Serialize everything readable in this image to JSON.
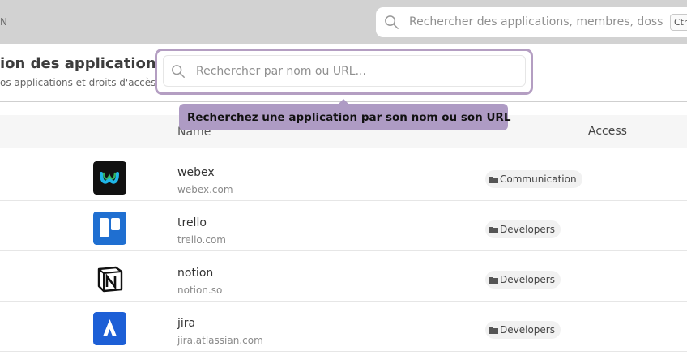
{
  "topbar": {
    "brand": "N",
    "global_search_placeholder": "Rechercher des applications, membres, doss",
    "shortcut": "Ctr"
  },
  "page": {
    "title": "ion des applications",
    "subtitle": "os applications et droits d'accès"
  },
  "search": {
    "placeholder": "Rechercher par nom ou URL..."
  },
  "tooltip": {
    "text": "Recherchez une application par son nom ou son URL"
  },
  "table": {
    "columns": {
      "name": "Name",
      "access": "Access"
    },
    "rows": [
      {
        "name": "webex",
        "url": "webex.com",
        "tag": "Communication",
        "logo": "webex-logo"
      },
      {
        "name": "trello",
        "url": "trello.com",
        "tag": "Developers",
        "logo": "trello-logo"
      },
      {
        "name": "notion",
        "url": "notion.so",
        "tag": "Developers",
        "logo": "notion-logo"
      },
      {
        "name": "jira",
        "url": "jira.atlassian.com",
        "tag": "Developers",
        "logo": "jira-logo"
      }
    ]
  },
  "colors": {
    "accent_border": "#b49ec2",
    "tooltip_bg": "#ae9bc4",
    "topbar_bg": "#d2d2d2",
    "trello_blue": "#1f6fd1",
    "jira_blue": "#1d5fd6"
  }
}
